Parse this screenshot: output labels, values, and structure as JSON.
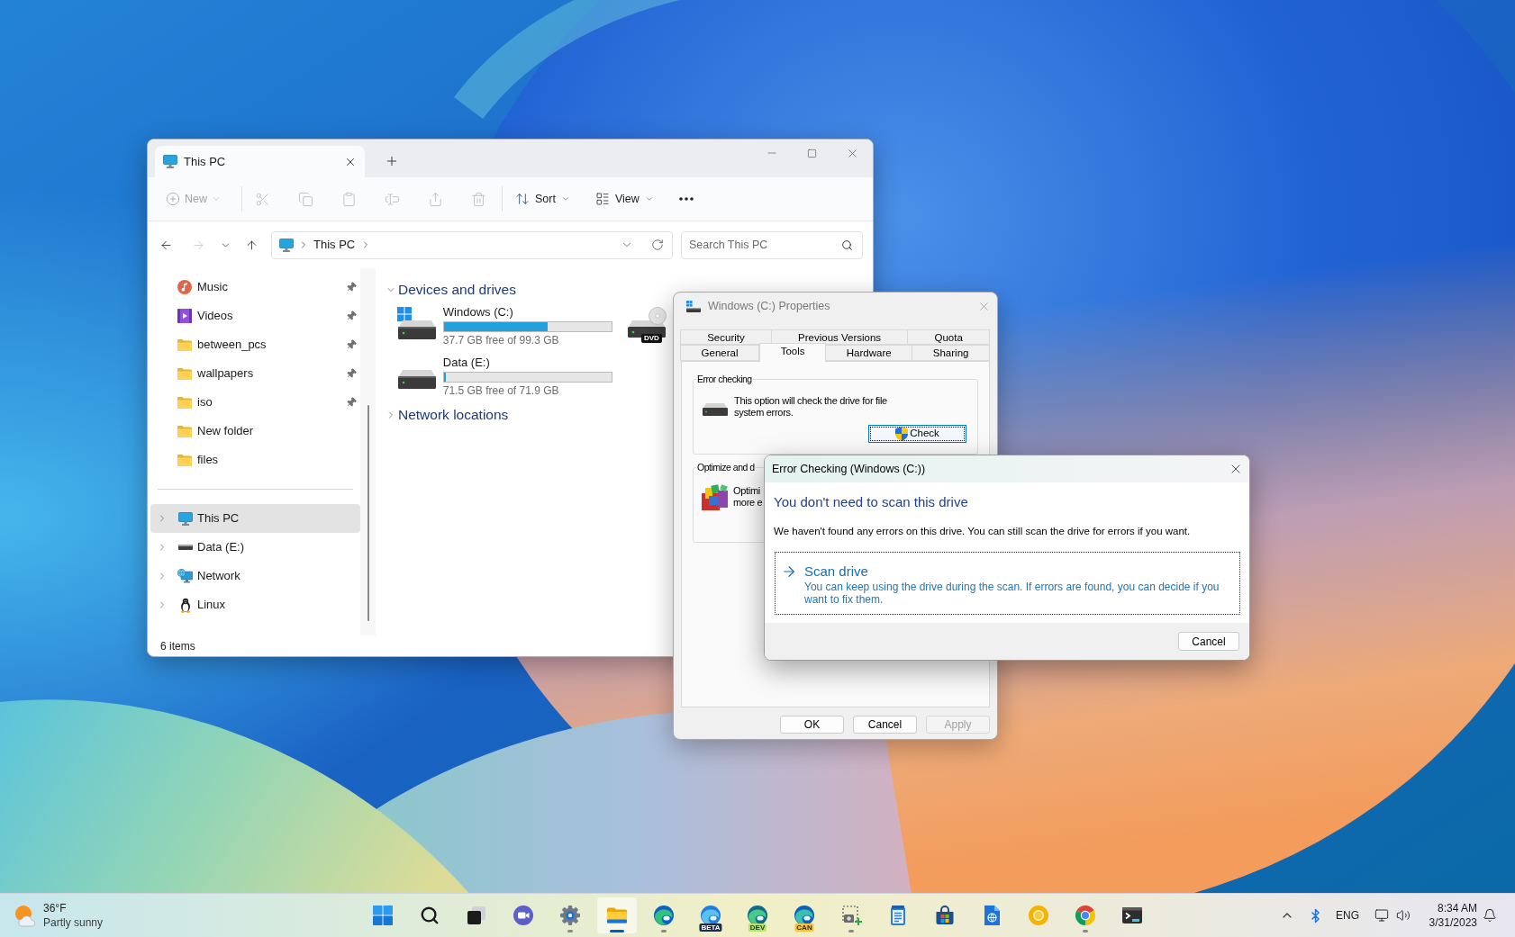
{
  "explorer": {
    "tabs": [
      {
        "label": "This PC",
        "selected": true
      }
    ],
    "toolbar": {
      "new_button": {
        "label": "New",
        "disabled": true
      },
      "actions": [
        {
          "disabled": true
        },
        {
          "disabled": true
        },
        {
          "disabled": true
        },
        {
          "disabled": true
        },
        {
          "disabled": true
        },
        {
          "disabled": true
        }
      ],
      "sort_button": {
        "label": "Sort"
      },
      "view_button": {
        "label": "View"
      }
    },
    "navigation": [
      {
        "disabled": false
      },
      {
        "disabled": true
      },
      {
        "disabled": false
      },
      {
        "disabled": false
      }
    ],
    "address_bar": {
      "path": [
        "This PC"
      ]
    },
    "search": {
      "placeholder": "Search This PC"
    },
    "sidebar": {
      "quick_access": [
        {
          "label": "Music",
          "kind": "music",
          "pinned": true
        },
        {
          "label": "Videos",
          "kind": "video",
          "pinned": true
        },
        {
          "label": "between_pcs",
          "kind": "folder",
          "pinned": true
        },
        {
          "label": "wallpapers",
          "kind": "folder",
          "pinned": true
        },
        {
          "label": "iso",
          "kind": "folder",
          "pinned": true
        },
        {
          "label": "New folder",
          "kind": "folder",
          "pinned": false
        },
        {
          "label": "files",
          "kind": "folder",
          "pinned": false
        }
      ],
      "tree": [
        {
          "label": "This PC",
          "kind": "pc",
          "selected": true,
          "expanded": false
        },
        {
          "label": "Data (E:)",
          "kind": "drive",
          "selected": false,
          "expanded": false
        },
        {
          "label": "Network",
          "kind": "network",
          "selected": false,
          "expanded": false
        },
        {
          "label": "Linux",
          "kind": "linux",
          "selected": false,
          "expanded": false
        }
      ]
    },
    "sections": [
      {
        "title": "Devices and drives",
        "expanded": true,
        "drives": [
          {
            "kind": "system",
            "name": "Windows (C:)",
            "space": "37.7 GB free of 99.3 GB",
            "level": 0.62
          },
          {
            "kind": "disk",
            "name": "Data (E:)",
            "space": "71.5 GB free of 71.9 GB",
            "level": 0.01
          },
          {
            "kind": "dvd",
            "badge": "DVD"
          }
        ]
      },
      {
        "title": "Network locations",
        "expanded": false
      }
    ],
    "status_bar": {
      "item_count": "6 items"
    }
  },
  "properties_dialog": {
    "title": "Windows (C:) Properties",
    "active": false,
    "tab_rows": [
      {
        "tabs": [
          {
            "label": "Security",
            "selected": false
          },
          {
            "label": "Previous Versions",
            "selected": false
          },
          {
            "label": "Quota",
            "selected": false
          }
        ]
      },
      {
        "tabs": [
          {
            "label": "General",
            "selected": false
          },
          {
            "label": "Tools",
            "selected": true
          },
          {
            "label": "Hardware",
            "selected": false
          },
          {
            "label": "Sharing",
            "selected": false
          }
        ]
      }
    ],
    "groups": [
      {
        "kind": "error_checking",
        "title": "Error checking",
        "description": "This option will check the drive for file system errors.",
        "button": {
          "label": "Check",
          "focused": true
        }
      },
      {
        "kind": "optimize",
        "title": "Optimize and d",
        "lines": [
          "Optimi",
          "more e"
        ]
      }
    ],
    "buttons": [
      {
        "label": "OK",
        "disabled": false
      },
      {
        "label": "Cancel",
        "disabled": false
      },
      {
        "label": "Apply",
        "disabled": true
      }
    ]
  },
  "error_dialog": {
    "title": "Error Checking (Windows (C:))",
    "active": true,
    "heading": "You don't need to scan this drive",
    "message": "We haven't found any errors on this drive. You can still scan the drive for errors if you want.",
    "command_link": {
      "title": "Scan drive",
      "description": "You can keep using the drive during the scan. If errors are found, you can decide if you want to fix them.",
      "focused": true
    },
    "buttons": [
      {
        "label": "Cancel"
      }
    ]
  },
  "taskbar": {
    "weather": {
      "temperature": "36°F",
      "condition": "Partly sunny"
    },
    "apps": [
      {
        "kind": "start",
        "running": false,
        "active": false
      },
      {
        "kind": "search",
        "running": false,
        "active": false
      },
      {
        "kind": "task_view",
        "running": false,
        "active": false
      },
      {
        "kind": "chat",
        "running": false,
        "active": false
      },
      {
        "kind": "settings",
        "running": true,
        "active": false
      },
      {
        "kind": "file_explorer",
        "running": true,
        "active": true
      },
      {
        "kind": "edge",
        "running": true,
        "active": false
      },
      {
        "kind": "edge_beta",
        "badge": "BETA",
        "running": false,
        "active": false
      },
      {
        "kind": "edge_dev",
        "badge": "DEV",
        "running": false,
        "active": false
      },
      {
        "kind": "edge_canary",
        "badge": "CAN",
        "running": false,
        "active": false
      },
      {
        "kind": "snipping_tool",
        "running": true,
        "active": false
      },
      {
        "kind": "notepad",
        "running": false,
        "active": false
      },
      {
        "kind": "store",
        "running": false,
        "active": false
      },
      {
        "kind": "web_document",
        "running": false,
        "active": false
      },
      {
        "kind": "chrome_canary",
        "running": false,
        "active": false
      },
      {
        "kind": "chrome",
        "running": true,
        "active": false
      },
      {
        "kind": "terminal",
        "running": false,
        "active": false
      }
    ],
    "tray": {
      "language": "ENG",
      "time": "8:34 AM",
      "date": "3/31/2023"
    }
  }
}
